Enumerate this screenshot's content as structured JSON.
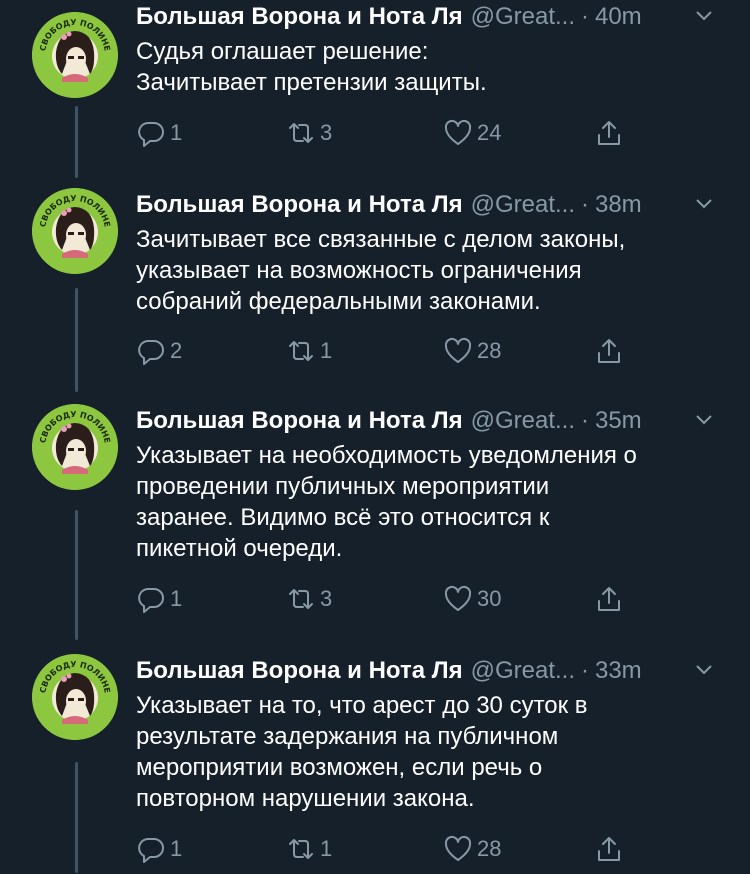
{
  "tweets": [
    {
      "name": "Большая Ворона и Нота Ля",
      "handle": "@Great...",
      "time": "40m",
      "text": "Судья оглашает решение:\nЗачитывает претензии защиты.",
      "replies": "1",
      "retweets": "3",
      "likes": "24"
    },
    {
      "name": "Большая Ворона и Нота Ля",
      "handle": "@Great...",
      "time": "38m",
      "text": "Зачитывает все связанные с делом законы,\nуказывает на возможность ограничения\nсобраний федеральными законами.",
      "replies": "2",
      "retweets": "1",
      "likes": "28"
    },
    {
      "name": "Большая Ворона и Нота Ля",
      "handle": "@Great...",
      "time": "35m",
      "text": "Указывает на необходимость уведомления о\nпроведении публичных мероприятии\nзаранее. Видимо всё это относится к\nпикетной очереди.",
      "replies": "1",
      "retweets": "3",
      "likes": "30"
    },
    {
      "name": "Большая Ворона и Нота Ля",
      "handle": "@Great...",
      "time": "33m",
      "text": "Указывает на то, что арест до 30 суток в\nрезультате задержания на публичном\nмероприятии возможен, если речь о\nповторном нарушении закона.",
      "replies": "1",
      "retweets": "1",
      "likes": "28"
    }
  ],
  "avatar_text": "СВОБОДУ ПОЛИНЕ",
  "colors": {
    "background": "#15202b",
    "secondary_text": "#8899a6",
    "avatar_bg": "#8dc63f",
    "thread_line": "#3d5466"
  },
  "icons": {
    "reply": "reply-icon",
    "retweet": "retweet-icon",
    "like": "heart-icon",
    "share": "share-icon",
    "menu": "chevron-down-icon"
  }
}
